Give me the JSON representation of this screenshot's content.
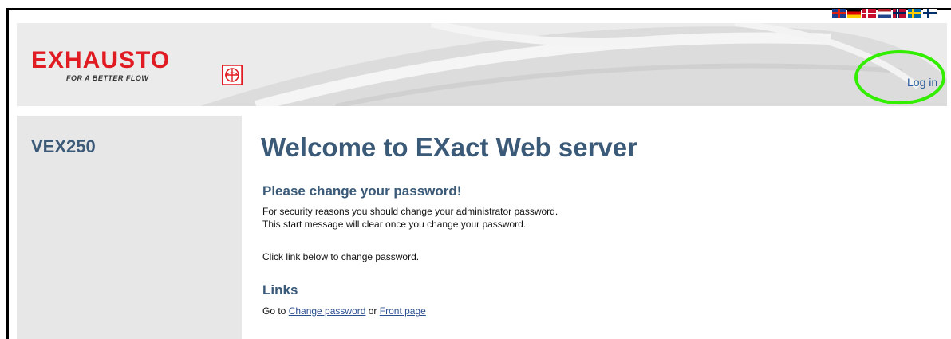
{
  "header": {
    "logo_word": "EXHAUSTO",
    "logo_tagline": "FOR A BETTER FLOW",
    "login_label": "Log in",
    "languages": [
      "uk-flag-icon",
      "de-flag-icon",
      "dk-flag-icon",
      "nl-flag-icon",
      "no-flag-icon",
      "se-flag-icon",
      "fi-flag-icon"
    ]
  },
  "sidebar": {
    "device_name": "VEX250"
  },
  "main": {
    "title": "Welcome to EXact Web server",
    "password_heading": "Please change your password!",
    "security_line1": "For security reasons you should change your administrator password.",
    "security_line2": "This start message will clear once you change your password.",
    "click_instruction": "Click link below to change password.",
    "links_heading": "Links",
    "links_prefix": "Go to ",
    "change_password_link": "Change password",
    "links_or": " or ",
    "front_page_link": "Front page"
  },
  "colors": {
    "brand_red": "#e01b22",
    "heading_blue": "#3a5a78",
    "link_blue": "#2b5f9e",
    "highlight_green": "#33ee00",
    "sidebar_bg": "#e7e7e7",
    "header_bg": "#ebebeb"
  }
}
